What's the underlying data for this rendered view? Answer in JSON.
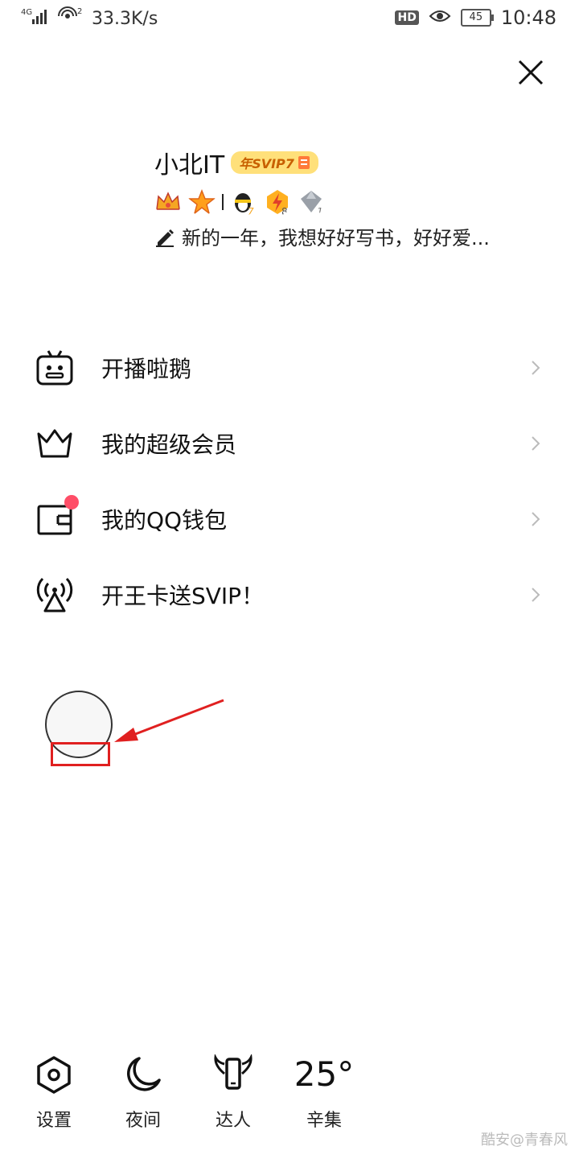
{
  "status_bar": {
    "net_type": "4G",
    "speed": "33.3K/s",
    "hotspot_count": "2",
    "hd": "HD",
    "battery": "45",
    "time": "10:48"
  },
  "profile": {
    "name": "小北IT",
    "svip_badge": "年SVIP7",
    "signature": "新的一年，我想好好写书，好好爱..."
  },
  "menu": {
    "items": [
      {
        "label": "开播啦鹅",
        "icon": "tv-robot-icon"
      },
      {
        "label": "我的超级会员",
        "icon": "crown-icon"
      },
      {
        "label": "我的QQ钱包",
        "icon": "wallet-icon"
      },
      {
        "label": "开王卡送SVIP！",
        "icon": "signal-tower-icon"
      }
    ]
  },
  "toolbar": {
    "settings": "设置",
    "night": "夜间",
    "expert": "达人",
    "temperature": "25°",
    "city": "辛集"
  },
  "watermark": "酷安@青春风",
  "colors": {
    "accent_red": "#e02020",
    "badge_dot": "#ff4d67",
    "svip_gold": "#ffe07a"
  }
}
